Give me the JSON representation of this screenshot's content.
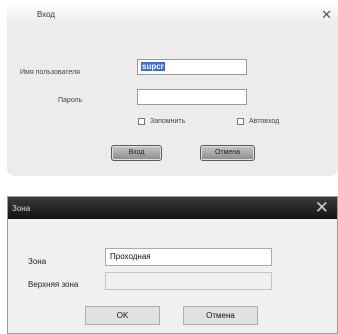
{
  "login_dialog": {
    "title": "Вход",
    "close_glyph": "✕",
    "username_label": "Имя пользователя",
    "username_value": "supcr",
    "password_label": "Пароль",
    "password_value": "",
    "remember_label": "Запомнить",
    "autologin_label": "Автовход",
    "login_button": "Вход",
    "cancel_button": "Отмена"
  },
  "zone_dialog": {
    "title": "Зона",
    "close_glyph": "✕",
    "zone_label": "Зона",
    "zone_value": "Проходная",
    "upper_zone_label": "Верхняя зона",
    "upper_zone_value": "",
    "ok_button": "OK",
    "cancel_button": "Отмена"
  },
  "colors": {
    "selection": "#3a6fd8",
    "dark_titlebar": "#1c1c1c",
    "dialog_bg": "#ececec"
  }
}
